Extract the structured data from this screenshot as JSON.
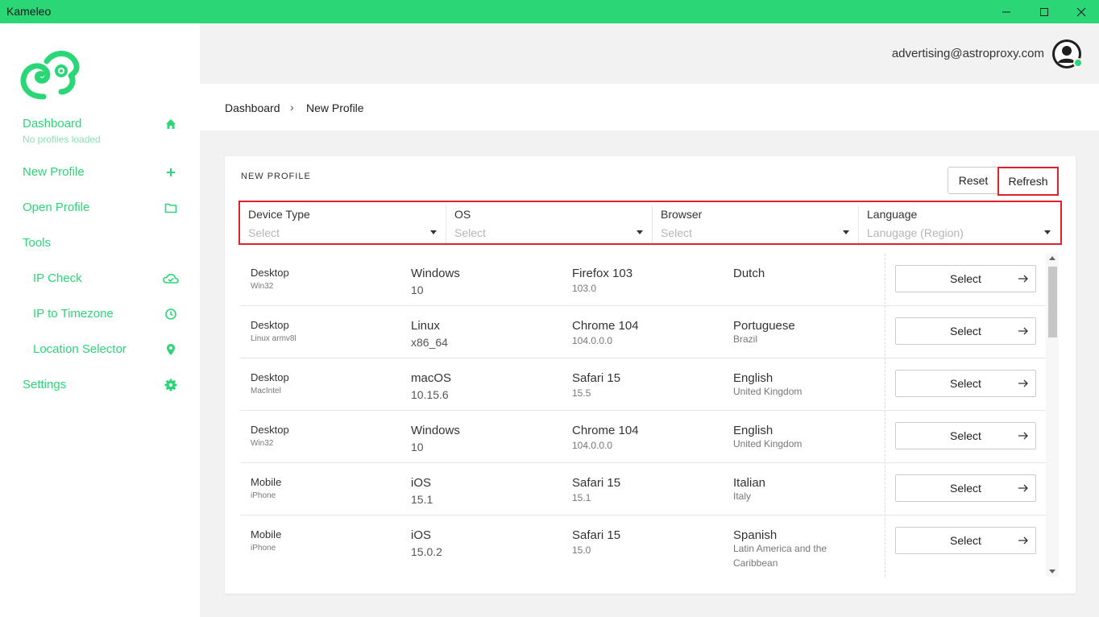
{
  "app": {
    "title": "Kameleo"
  },
  "sidebar": {
    "items": [
      {
        "label": "Dashboard",
        "sub": "No profiles loaded",
        "icon": "home-icon"
      },
      {
        "label": "New Profile",
        "icon": "plus-icon"
      },
      {
        "label": "Open Profile",
        "icon": "folder-icon"
      },
      {
        "label": "Tools"
      },
      {
        "label": "IP Check",
        "icon": "cloud-check-icon"
      },
      {
        "label": "IP to Timezone",
        "icon": "clock-icon"
      },
      {
        "label": "Location Selector",
        "icon": "location-pin-icon"
      },
      {
        "label": "Settings",
        "icon": "gear-icon"
      }
    ]
  },
  "header": {
    "email": "advertising@astroproxy.com"
  },
  "breadcrumb": {
    "root": "Dashboard",
    "separator": "›",
    "current": "New Profile"
  },
  "card": {
    "title": "NEW PROFILE",
    "reset_label": "Reset",
    "refresh_label": "Refresh"
  },
  "filters": [
    {
      "label": "Device Type",
      "value": "Select"
    },
    {
      "label": "OS",
      "value": "Select"
    },
    {
      "label": "Browser",
      "value": "Select"
    },
    {
      "label": "Language",
      "value": "Lanugage (Region)"
    }
  ],
  "profiles": [
    {
      "device": "Desktop",
      "platform": "Win32",
      "os": "Windows",
      "os_version": "10",
      "browser": "Firefox 103",
      "browser_version": "103.0",
      "language": "Dutch",
      "region": "",
      "select_label": "Select"
    },
    {
      "device": "Desktop",
      "platform": "Linux armv8l",
      "os": "Linux",
      "os_version": "x86_64",
      "browser": "Chrome 104",
      "browser_version": "104.0.0.0",
      "language": "Portuguese",
      "region": "Brazil",
      "select_label": "Select"
    },
    {
      "device": "Desktop",
      "platform": "MacIntel",
      "os": "macOS",
      "os_version": "10.15.6",
      "browser": "Safari 15",
      "browser_version": "15.5",
      "language": "English",
      "region": "United Kingdom",
      "select_label": "Select"
    },
    {
      "device": "Desktop",
      "platform": "Win32",
      "os": "Windows",
      "os_version": "10",
      "browser": "Chrome 104",
      "browser_version": "104.0.0.0",
      "language": "English",
      "region": "United Kingdom",
      "select_label": "Select"
    },
    {
      "device": "Mobile",
      "platform": "iPhone",
      "os": "iOS",
      "os_version": "15.1",
      "browser": "Safari 15",
      "browser_version": "15.1",
      "language": "Italian",
      "region": "Italy",
      "select_label": "Select"
    },
    {
      "device": "Mobile",
      "platform": "iPhone",
      "os": "iOS",
      "os_version": "15.0.2",
      "browser": "Safari 15",
      "browser_version": "15.0",
      "language": "Spanish",
      "region": "Latin America and the Caribbean",
      "select_label": "Select"
    }
  ],
  "colors": {
    "accent": "#2bd676",
    "highlight": "#e0202a"
  }
}
